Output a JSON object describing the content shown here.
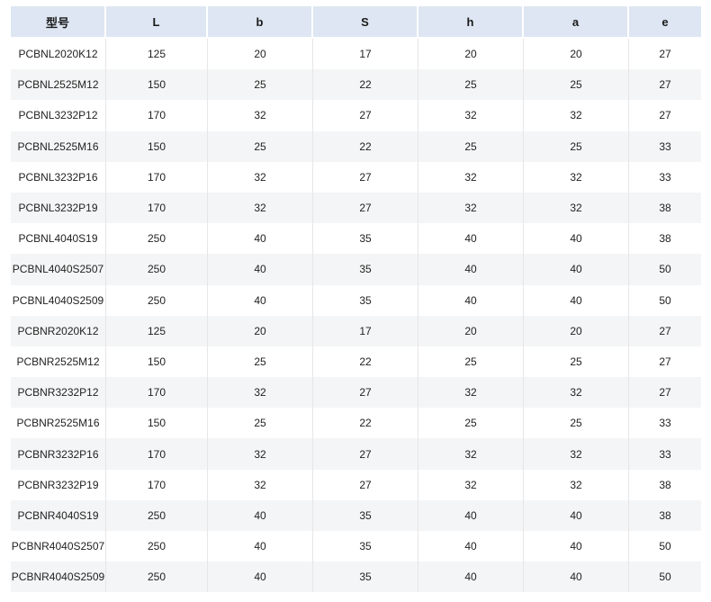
{
  "table": {
    "headers": [
      "型号",
      "L",
      "b",
      "S",
      "h",
      "a",
      "e"
    ],
    "rows": [
      [
        "PCBNL2020K12",
        "125",
        "20",
        "17",
        "20",
        "20",
        "27"
      ],
      [
        "PCBNL2525M12",
        "150",
        "25",
        "22",
        "25",
        "25",
        "27"
      ],
      [
        "PCBNL3232P12",
        "170",
        "32",
        "27",
        "32",
        "32",
        "27"
      ],
      [
        "PCBNL2525M16",
        "150",
        "25",
        "22",
        "25",
        "25",
        "33"
      ],
      [
        "PCBNL3232P16",
        "170",
        "32",
        "27",
        "32",
        "32",
        "33"
      ],
      [
        "PCBNL3232P19",
        "170",
        "32",
        "27",
        "32",
        "32",
        "38"
      ],
      [
        "PCBNL4040S19",
        "250",
        "40",
        "35",
        "40",
        "40",
        "38"
      ],
      [
        "PCBNL4040S2507",
        "250",
        "40",
        "35",
        "40",
        "40",
        "50"
      ],
      [
        "PCBNL4040S2509",
        "250",
        "40",
        "35",
        "40",
        "40",
        "50"
      ],
      [
        "PCBNR2020K12",
        "125",
        "20",
        "17",
        "20",
        "20",
        "27"
      ],
      [
        "PCBNR2525M12",
        "150",
        "25",
        "22",
        "25",
        "25",
        "27"
      ],
      [
        "PCBNR3232P12",
        "170",
        "32",
        "27",
        "32",
        "32",
        "27"
      ],
      [
        "PCBNR2525M16",
        "150",
        "25",
        "22",
        "25",
        "25",
        "33"
      ],
      [
        "PCBNR3232P16",
        "170",
        "32",
        "27",
        "32",
        "32",
        "33"
      ],
      [
        "PCBNR3232P19",
        "170",
        "32",
        "27",
        "32",
        "32",
        "38"
      ],
      [
        "PCBNR4040S19",
        "250",
        "40",
        "35",
        "40",
        "40",
        "38"
      ],
      [
        "PCBNR4040S2507",
        "250",
        "40",
        "35",
        "40",
        "40",
        "50"
      ],
      [
        "PCBNR4040S2509",
        "250",
        "40",
        "35",
        "40",
        "40",
        "50"
      ]
    ]
  },
  "colors": {
    "header_bg": "#dde6f2",
    "row_alt_bg": "#f4f5f6"
  }
}
